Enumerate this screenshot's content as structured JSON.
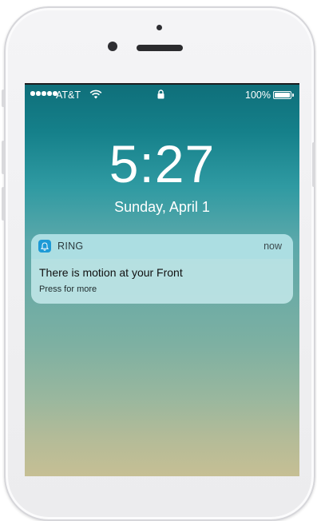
{
  "status_bar": {
    "carrier": "AT&T",
    "battery": "100%",
    "icons": [
      "signal-dots-icon",
      "wifi-icon",
      "lock-icon",
      "battery-icon"
    ]
  },
  "lock_screen": {
    "time": "5:27",
    "date": "Sunday, April 1"
  },
  "notification": {
    "app_name": "RING",
    "app_icon": "bell-icon",
    "app_icon_color": "#1d9ad6",
    "time": "now",
    "title": "There is motion at your Front",
    "subtitle": "Press for more"
  }
}
